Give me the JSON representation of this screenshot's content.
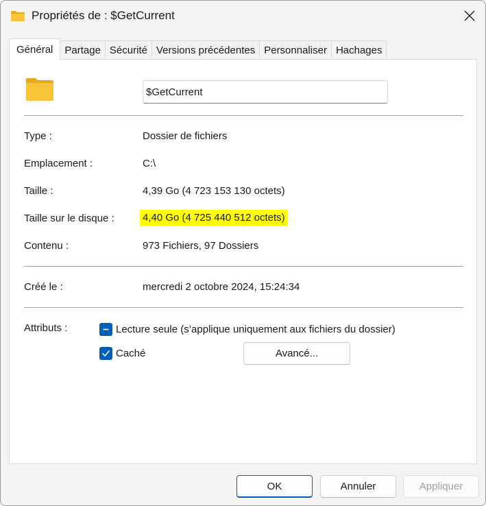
{
  "window": {
    "title": "Propriétés de : $GetCurrent"
  },
  "tabs": [
    {
      "label": "Général",
      "active": true
    },
    {
      "label": "Partage"
    },
    {
      "label": "Sécurité"
    },
    {
      "label": "Versions précédentes"
    },
    {
      "label": "Personnaliser"
    },
    {
      "label": "Hachages"
    }
  ],
  "general": {
    "name_value": "$GetCurrent",
    "type": {
      "label": "Type :",
      "value": "Dossier de fichiers"
    },
    "location": {
      "label": "Emplacement :",
      "value": "C:\\"
    },
    "size": {
      "label": "Taille :",
      "value": "4,39 Go (4 723 153 130 octets)"
    },
    "size_on_disk": {
      "label": "Taille sur le disque :",
      "value": "4,40 Go (4 725 440 512 octets)",
      "highlight_color": "#ffff00"
    },
    "contents": {
      "label": "Contenu :",
      "value": "973 Fichiers, 97 Dossiers"
    },
    "created": {
      "label": "Créé le :",
      "value": "mercredi 2 octobre 2024, 15:24:34"
    },
    "attributes": {
      "label": "Attributs :",
      "readonly_label": "Lecture seule (s’applique uniquement aux fichiers du dossier)",
      "readonly_state": "indeterminate",
      "hidden_label": "Caché",
      "hidden_state": "checked",
      "advanced_button": "Avancé..."
    }
  },
  "footer": {
    "ok": "OK",
    "cancel": "Annuler",
    "apply": "Appliquer"
  },
  "colors": {
    "accent": "#005fb8",
    "folder": "#f8c53a",
    "highlight": "#ffff00"
  },
  "icons": {
    "title": "folder-icon",
    "close": "close-icon",
    "big": "folder-icon",
    "checkbox_mixed": "dash-icon",
    "checkbox_checked": "checkmark-icon"
  }
}
